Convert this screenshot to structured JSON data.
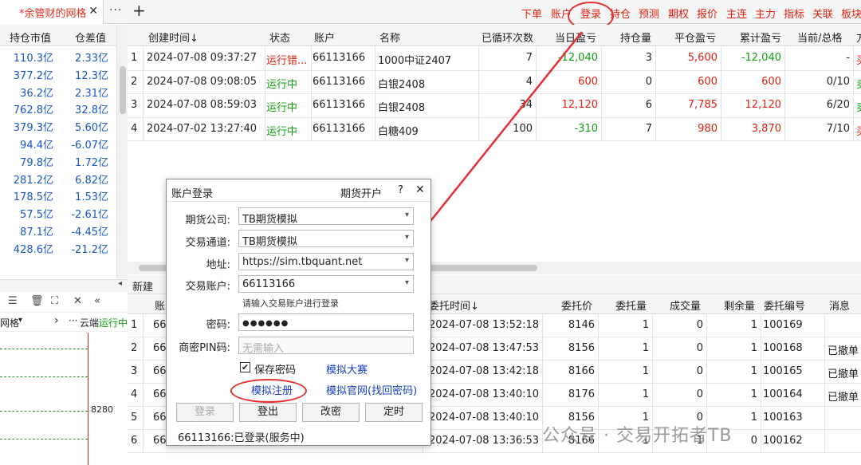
{
  "tab": {
    "title": "*余管财的网格",
    "close": "✕"
  },
  "toolbar": {
    "more": "···",
    "plus": "+"
  },
  "menu": [
    "下单",
    "账户",
    "登录",
    "持仓",
    "预测",
    "期权",
    "报价",
    "主连",
    "主力",
    "指标",
    "关联",
    "板块"
  ],
  "left_table": {
    "headers": [
      "持仓市值",
      "仓差值"
    ],
    "rows": [
      [
        "110.3亿",
        "2.33亿"
      ],
      [
        "377.2亿",
        "12.3亿"
      ],
      [
        "36.2亿",
        "2.31亿"
      ],
      [
        "762.8亿",
        "32.8亿"
      ],
      [
        "379.3亿",
        "5.60亿"
      ],
      [
        "94.4亿",
        "-6.07亿"
      ],
      [
        "79.8亿",
        "1.72亿"
      ],
      [
        "281.2亿",
        "6.82亿"
      ],
      [
        "178.5亿",
        "1.53亿"
      ],
      [
        "57.5亿",
        "-2.61亿"
      ],
      [
        "87.1亿",
        "-4.45亿"
      ],
      [
        "428.6亿",
        "-21.2亿"
      ]
    ]
  },
  "left_panel": {
    "tab_arrow": "◂",
    "tool_icons": [
      "☰",
      "🗑",
      "⛶",
      "✕",
      "«"
    ],
    "sub": {
      "label": "网格",
      "dropdown": "▾",
      "arrow": "›",
      "dots": "···",
      "cloud": "云端",
      "running": "运行中"
    },
    "price_label": "8280"
  },
  "main_table": {
    "headers": [
      "创建时间↓",
      "状态",
      "账户",
      "名称",
      "已循环次数",
      "当日盈亏",
      "持仓量",
      "平仓盈亏",
      "累计盈亏",
      "当前/总格",
      "方"
    ],
    "rows": [
      {
        "idx": "1",
        "time": "2024-07-08 09:37:27",
        "status": "运行错...",
        "account": "66113166",
        "name": "1000中证2407",
        "loops": "7",
        "daily": "-12,040",
        "pos": "3",
        "close": "5,600",
        "total": "-12,040",
        "grid": "-",
        "dir": "买"
      },
      {
        "idx": "2",
        "time": "2024-07-08 09:08:05",
        "status": "运行中",
        "account": "66113166",
        "name": "白银2408",
        "loops": "4",
        "daily": "600",
        "pos": "0",
        "close": "600",
        "total": "600",
        "grid": "0/10",
        "dir": "卖"
      },
      {
        "idx": "3",
        "time": "2024-07-08 08:59:03",
        "status": "运行中",
        "account": "66113166",
        "name": "白银2408",
        "loops": "34",
        "daily": "12,120",
        "pos": "6",
        "close": "7,785",
        "total": "12,120",
        "grid": "6/20",
        "dir": "卖"
      },
      {
        "idx": "4",
        "time": "2024-07-02 13:27:40",
        "status": "运行中",
        "account": "66113166",
        "name": "白糖409",
        "loops": "100",
        "daily": "-310",
        "pos": "7",
        "close": "980",
        "total": "3,870",
        "grid": "7/10",
        "dir": "买"
      }
    ]
  },
  "lower": {
    "new_tab": "新建",
    "headers": [
      "账",
      "委托时间↓",
      "委托价",
      "委托量",
      "成交量",
      "剩余量",
      "委托编号",
      "消息"
    ],
    "rows": [
      {
        "idx": "1",
        "acc": "66",
        "time": "2024-07-08 13:52:18",
        "price": "8146",
        "qty": "1",
        "filled": "0",
        "left": "1",
        "no": "100169",
        "msg": ""
      },
      {
        "idx": "2",
        "acc": "66",
        "time": "2024-07-08 13:47:53",
        "price": "8156",
        "qty": "1",
        "filled": "0",
        "left": "1",
        "no": "100168",
        "msg": "已撤单"
      },
      {
        "idx": "3",
        "acc": "66",
        "time": "2024-07-08 13:42:18",
        "price": "8166",
        "qty": "1",
        "filled": "0",
        "left": "1",
        "no": "100165",
        "msg": "已撤单"
      },
      {
        "idx": "4",
        "acc": "66",
        "time": "2024-07-08 13:40:10",
        "price": "8176",
        "qty": "1",
        "filled": "0",
        "left": "1",
        "no": "100164",
        "msg": "已撤单"
      },
      {
        "idx": "5",
        "acc": "66",
        "time": "2024-07-08 13:40:10",
        "price": "8156",
        "qty": "1",
        "filled": "0",
        "left": "1",
        "no": "100163",
        "msg": ""
      },
      {
        "idx": "6",
        "acc": "66",
        "time": "2024-07-08 13:36:53",
        "price": "8166",
        "qty": "1",
        "filled": "1",
        "left": "0",
        "no": "100162",
        "msg": ""
      }
    ]
  },
  "dialog": {
    "title": "账户登录",
    "open_account": "期货开户",
    "help": "?",
    "close": "✕",
    "dropdown": "▾",
    "check": "✔",
    "fields": {
      "company_label": "期货公司:",
      "company_value": "TB期货模拟",
      "channel_label": "交易通道:",
      "channel_value": "TB期货模拟",
      "address_label": "地址:",
      "address_value": "https://sim.tbquant.net",
      "account_label": "交易账户:",
      "account_value": "66113166",
      "account_hint": "请输入交易账户进行登录",
      "password_label": "密码:",
      "password_value": "●●●●●●",
      "pin_label": "商密PIN码:",
      "pin_placeholder": "无需输入"
    },
    "save_password": "保存密码",
    "links": {
      "contest": "模拟大赛",
      "register": "模拟注册",
      "official": "模拟官网(找回密码)"
    },
    "buttons": {
      "login": "登录",
      "logout": "登出",
      "change_pwd": "改密",
      "timer": "定时"
    },
    "status": "66113166:已登录(服务中)"
  },
  "watermark": "公众号 · 交易开拓者TB"
}
